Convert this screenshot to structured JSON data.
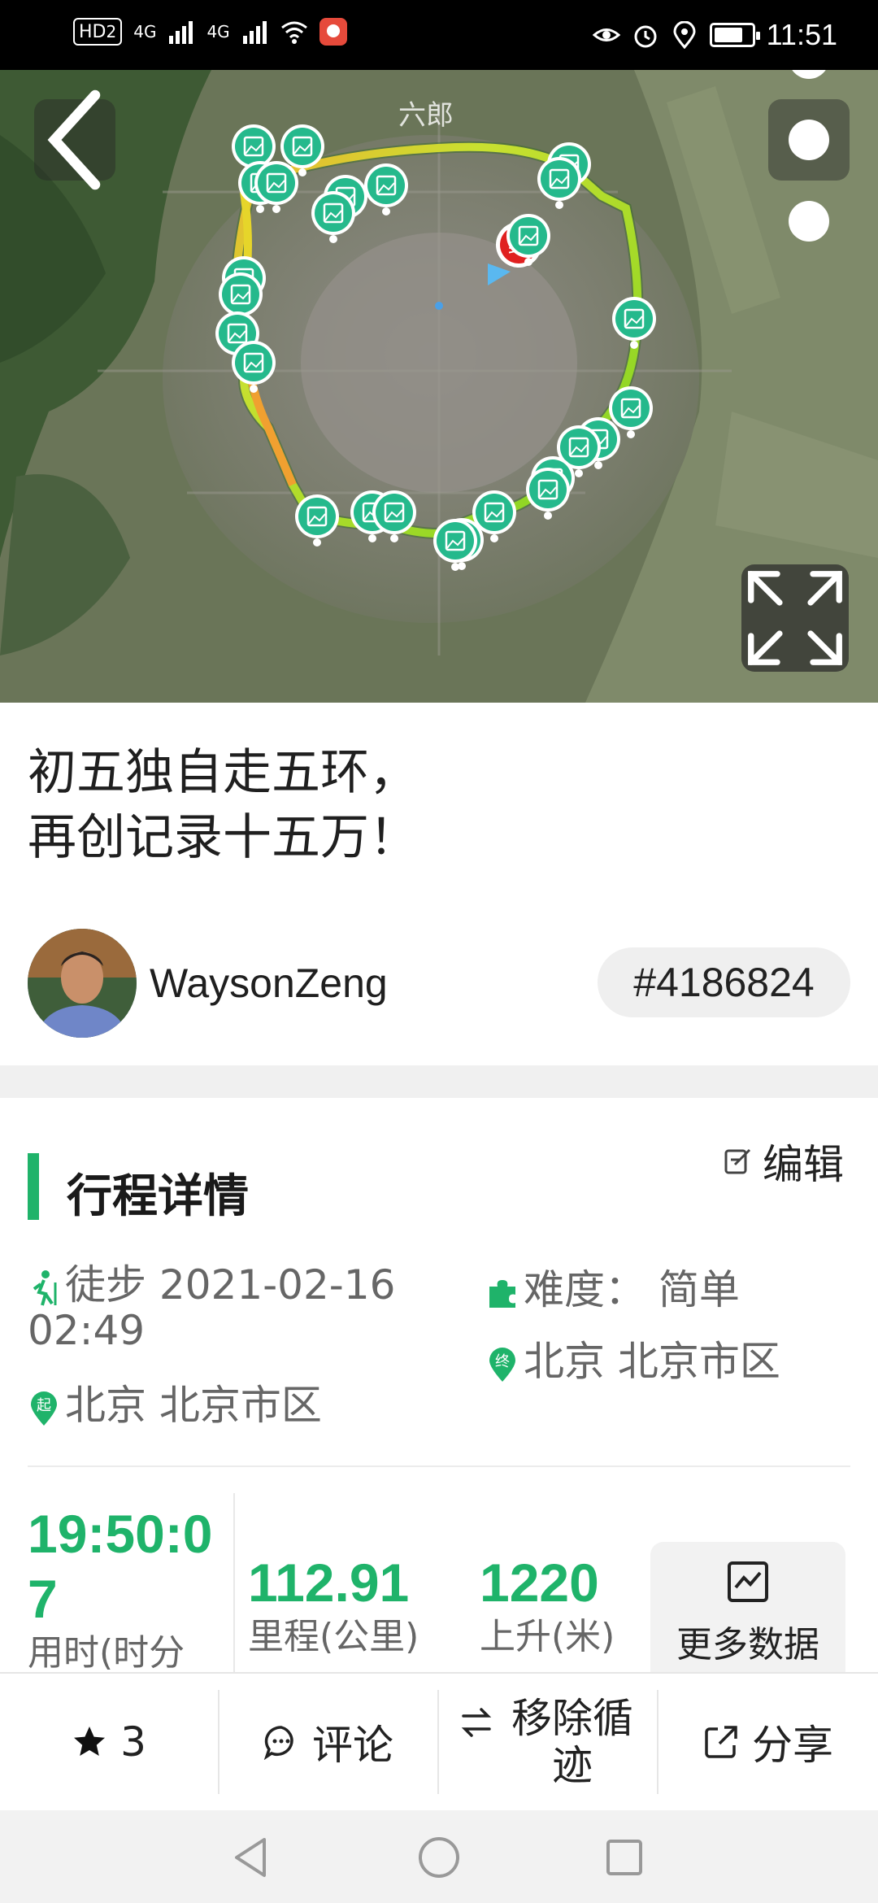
{
  "status_bar": {
    "hd_label": "HD",
    "hd_sub": "2",
    "net1": "4G",
    "net2": "4G",
    "time": "11:51"
  },
  "map": {
    "place_label": "六郎"
  },
  "trip": {
    "title": "初五独自走五环，\n再创记录十五万！",
    "author": "WaysonZeng",
    "trip_id": "#4186824"
  },
  "details": {
    "section_title": "行程详情",
    "edit_label": "编辑",
    "activity": "徒步 2021-02-16 02:49",
    "start_location": "北京 北京市区",
    "difficulty": "难度： 简单",
    "end_location": "北京 北京市区",
    "start_icon_text": "起",
    "end_icon_text": "终"
  },
  "stats": {
    "duration_value": "19:50:07",
    "duration_label": "用时(时分",
    "distance_value": "112.91",
    "distance_label": "里程(公里)",
    "ascent_value": "1220",
    "ascent_label": "上升(米)",
    "more_label": "更多数据"
  },
  "actions": {
    "star_count": "3",
    "comment_label": "评论",
    "remove_label": "移除循迹",
    "share_label": "分享"
  },
  "colors": {
    "accent": "#1fb36a",
    "marker": "#25b98c",
    "route_green": "#7ed321",
    "route_yellow": "#e6d52a",
    "route_orange": "#f0a030"
  }
}
